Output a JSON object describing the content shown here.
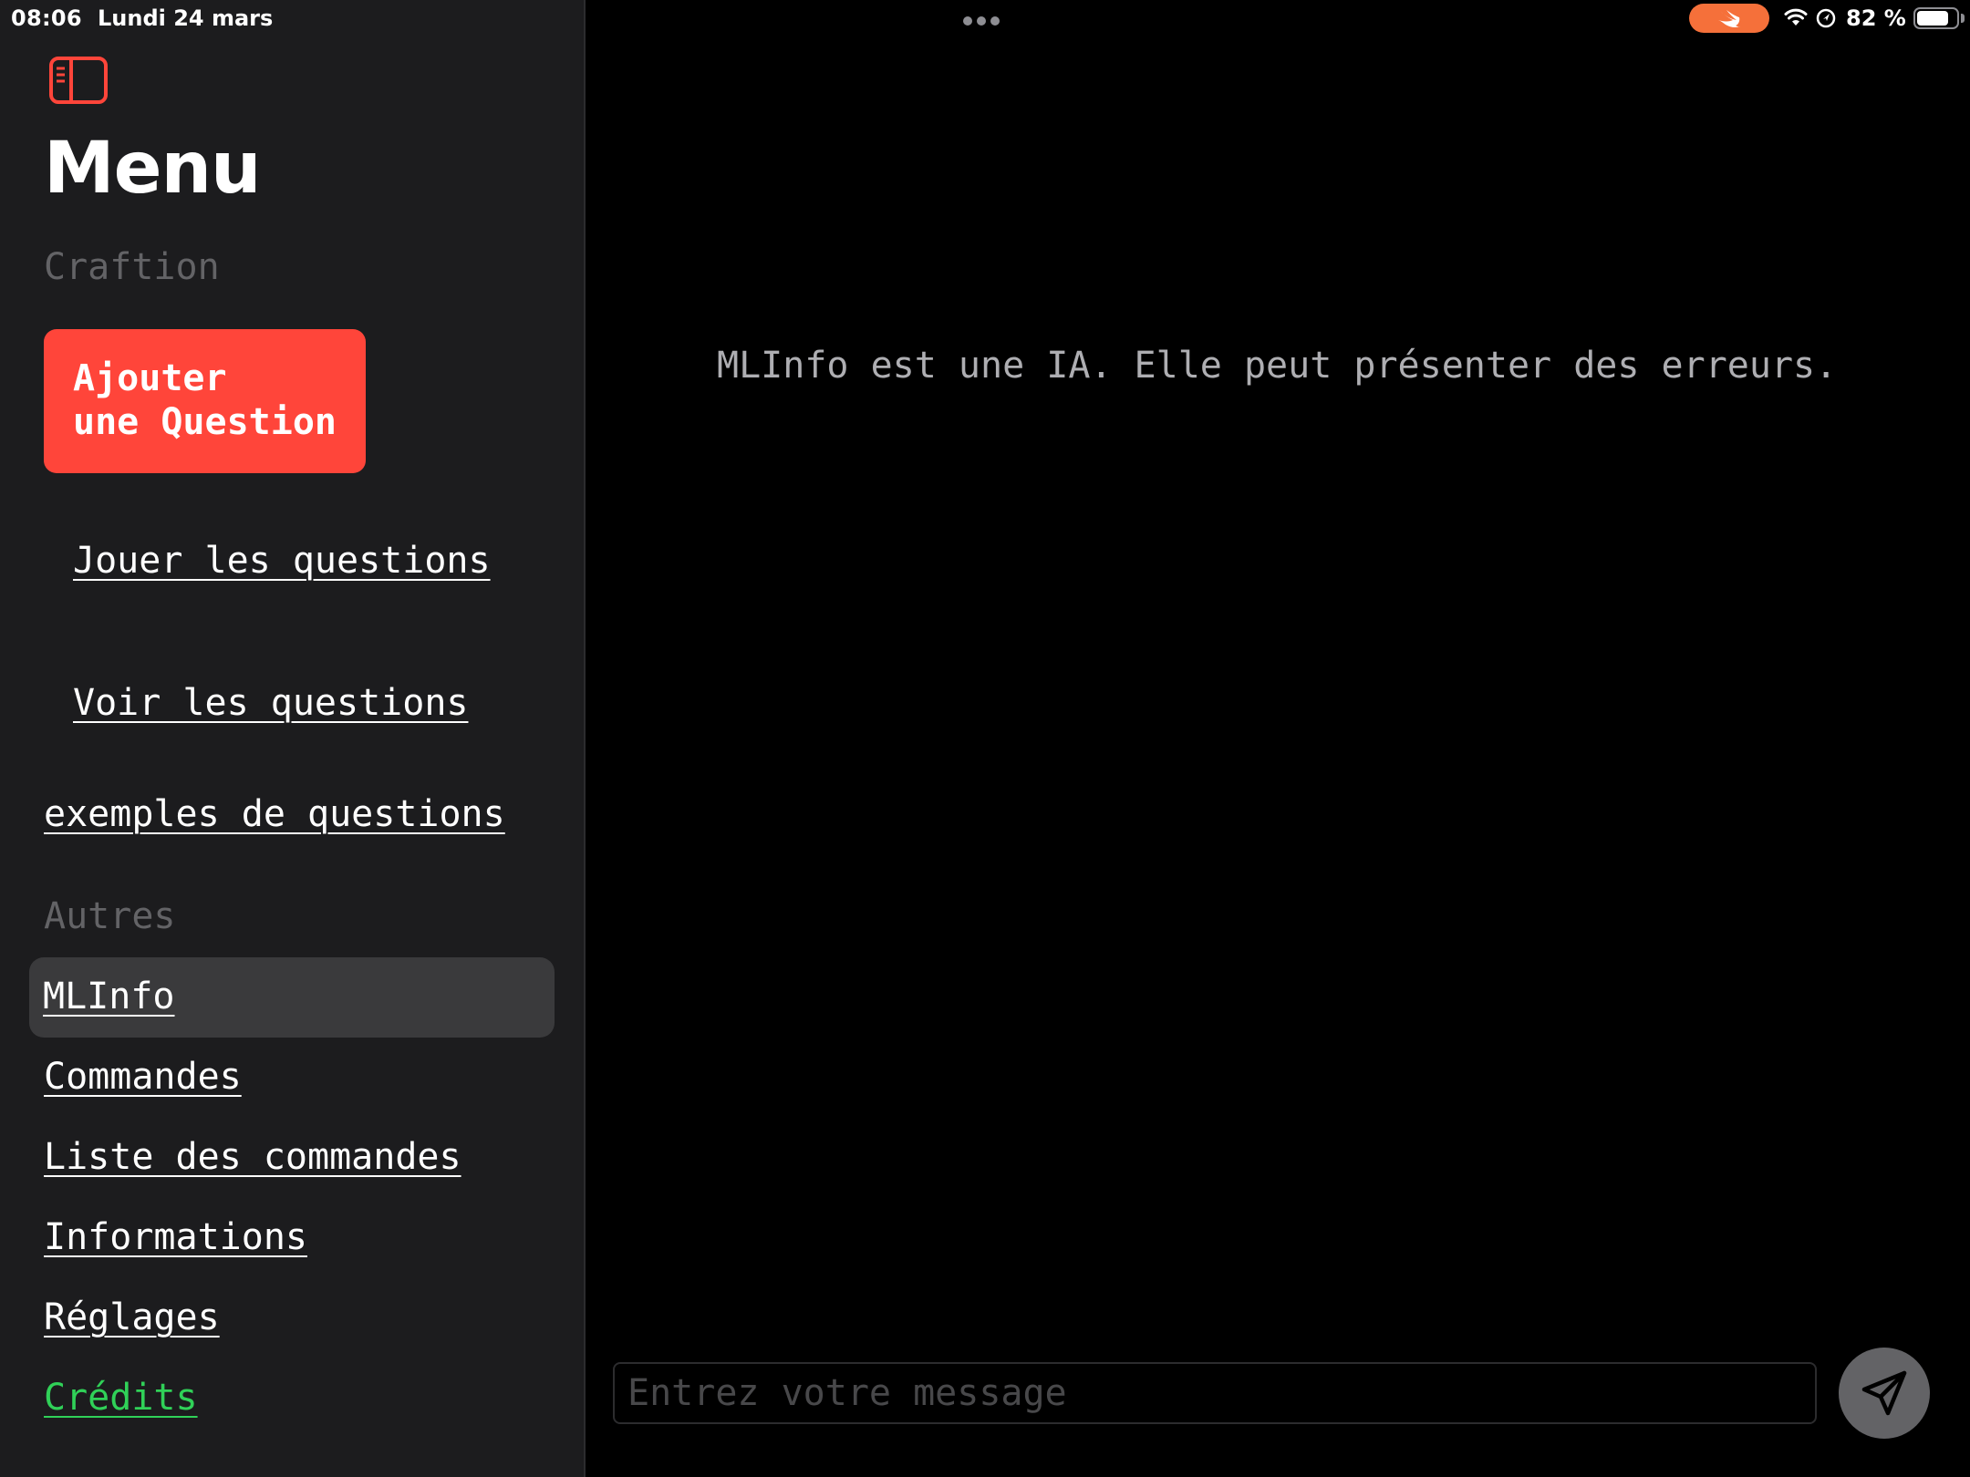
{
  "status_bar": {
    "time": "08:06",
    "date": "Lundi 24 mars",
    "battery_text": "82 %",
    "battery_level": 0.82,
    "swift_pill_color": "#f5703a"
  },
  "sidebar": {
    "title": "Menu",
    "toggle_icon": "sidebar-toggle-icon",
    "accent_color": "#ff453a",
    "section_craftion": "Craftion",
    "add_question_label": "Ajouter\nune Question",
    "links_craftion": {
      "jouer": "Jouer les questions",
      "voir": "Voir les questions",
      "exemples": "exemples de questions"
    },
    "section_autres": "Autres",
    "links_autres": {
      "mlinfo": "MLInfo",
      "commandes": "Commandes",
      "liste": "Liste des commandes",
      "informations": "Informations",
      "reglages": "Réglages",
      "credits": "Crédits"
    },
    "selected_item": "MLInfo",
    "credits_color": "#30d158"
  },
  "main": {
    "disclaimer": "MLInfo est une IA. Elle peut présenter des erreurs.",
    "input_placeholder": "Entrez votre message",
    "input_value": "",
    "send_icon": "send-icon"
  }
}
